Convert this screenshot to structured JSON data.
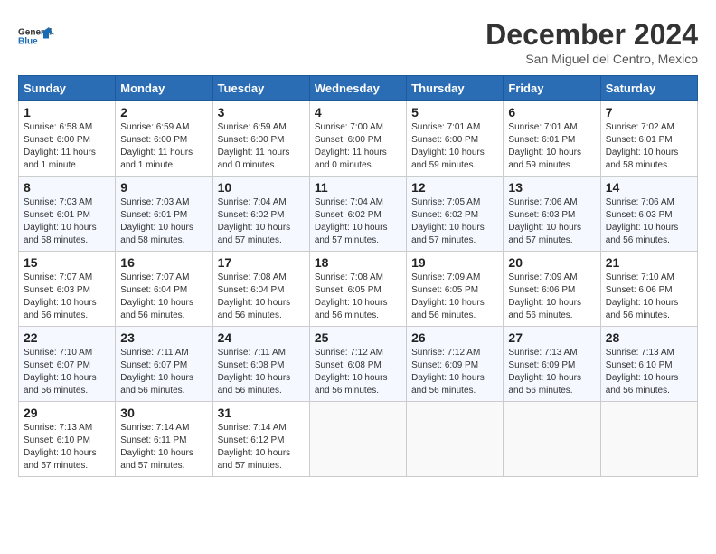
{
  "logo": {
    "line1": "General",
    "line2": "Blue"
  },
  "header": {
    "title": "December 2024",
    "subtitle": "San Miguel del Centro, Mexico"
  },
  "weekdays": [
    "Sunday",
    "Monday",
    "Tuesday",
    "Wednesday",
    "Thursday",
    "Friday",
    "Saturday"
  ],
  "weeks": [
    [
      {
        "day": "1",
        "info": "Sunrise: 6:58 AM\nSunset: 6:00 PM\nDaylight: 11 hours\nand 1 minute."
      },
      {
        "day": "2",
        "info": "Sunrise: 6:59 AM\nSunset: 6:00 PM\nDaylight: 11 hours\nand 1 minute."
      },
      {
        "day": "3",
        "info": "Sunrise: 6:59 AM\nSunset: 6:00 PM\nDaylight: 11 hours\nand 0 minutes."
      },
      {
        "day": "4",
        "info": "Sunrise: 7:00 AM\nSunset: 6:00 PM\nDaylight: 11 hours\nand 0 minutes."
      },
      {
        "day": "5",
        "info": "Sunrise: 7:01 AM\nSunset: 6:00 PM\nDaylight: 10 hours\nand 59 minutes."
      },
      {
        "day": "6",
        "info": "Sunrise: 7:01 AM\nSunset: 6:01 PM\nDaylight: 10 hours\nand 59 minutes."
      },
      {
        "day": "7",
        "info": "Sunrise: 7:02 AM\nSunset: 6:01 PM\nDaylight: 10 hours\nand 58 minutes."
      }
    ],
    [
      {
        "day": "8",
        "info": "Sunrise: 7:03 AM\nSunset: 6:01 PM\nDaylight: 10 hours\nand 58 minutes."
      },
      {
        "day": "9",
        "info": "Sunrise: 7:03 AM\nSunset: 6:01 PM\nDaylight: 10 hours\nand 58 minutes."
      },
      {
        "day": "10",
        "info": "Sunrise: 7:04 AM\nSunset: 6:02 PM\nDaylight: 10 hours\nand 57 minutes."
      },
      {
        "day": "11",
        "info": "Sunrise: 7:04 AM\nSunset: 6:02 PM\nDaylight: 10 hours\nand 57 minutes."
      },
      {
        "day": "12",
        "info": "Sunrise: 7:05 AM\nSunset: 6:02 PM\nDaylight: 10 hours\nand 57 minutes."
      },
      {
        "day": "13",
        "info": "Sunrise: 7:06 AM\nSunset: 6:03 PM\nDaylight: 10 hours\nand 57 minutes."
      },
      {
        "day": "14",
        "info": "Sunrise: 7:06 AM\nSunset: 6:03 PM\nDaylight: 10 hours\nand 56 minutes."
      }
    ],
    [
      {
        "day": "15",
        "info": "Sunrise: 7:07 AM\nSunset: 6:03 PM\nDaylight: 10 hours\nand 56 minutes."
      },
      {
        "day": "16",
        "info": "Sunrise: 7:07 AM\nSunset: 6:04 PM\nDaylight: 10 hours\nand 56 minutes."
      },
      {
        "day": "17",
        "info": "Sunrise: 7:08 AM\nSunset: 6:04 PM\nDaylight: 10 hours\nand 56 minutes."
      },
      {
        "day": "18",
        "info": "Sunrise: 7:08 AM\nSunset: 6:05 PM\nDaylight: 10 hours\nand 56 minutes."
      },
      {
        "day": "19",
        "info": "Sunrise: 7:09 AM\nSunset: 6:05 PM\nDaylight: 10 hours\nand 56 minutes."
      },
      {
        "day": "20",
        "info": "Sunrise: 7:09 AM\nSunset: 6:06 PM\nDaylight: 10 hours\nand 56 minutes."
      },
      {
        "day": "21",
        "info": "Sunrise: 7:10 AM\nSunset: 6:06 PM\nDaylight: 10 hours\nand 56 minutes."
      }
    ],
    [
      {
        "day": "22",
        "info": "Sunrise: 7:10 AM\nSunset: 6:07 PM\nDaylight: 10 hours\nand 56 minutes."
      },
      {
        "day": "23",
        "info": "Sunrise: 7:11 AM\nSunset: 6:07 PM\nDaylight: 10 hours\nand 56 minutes."
      },
      {
        "day": "24",
        "info": "Sunrise: 7:11 AM\nSunset: 6:08 PM\nDaylight: 10 hours\nand 56 minutes."
      },
      {
        "day": "25",
        "info": "Sunrise: 7:12 AM\nSunset: 6:08 PM\nDaylight: 10 hours\nand 56 minutes."
      },
      {
        "day": "26",
        "info": "Sunrise: 7:12 AM\nSunset: 6:09 PM\nDaylight: 10 hours\nand 56 minutes."
      },
      {
        "day": "27",
        "info": "Sunrise: 7:13 AM\nSunset: 6:09 PM\nDaylight: 10 hours\nand 56 minutes."
      },
      {
        "day": "28",
        "info": "Sunrise: 7:13 AM\nSunset: 6:10 PM\nDaylight: 10 hours\nand 56 minutes."
      }
    ],
    [
      {
        "day": "29",
        "info": "Sunrise: 7:13 AM\nSunset: 6:10 PM\nDaylight: 10 hours\nand 57 minutes."
      },
      {
        "day": "30",
        "info": "Sunrise: 7:14 AM\nSunset: 6:11 PM\nDaylight: 10 hours\nand 57 minutes."
      },
      {
        "day": "31",
        "info": "Sunrise: 7:14 AM\nSunset: 6:12 PM\nDaylight: 10 hours\nand 57 minutes."
      },
      null,
      null,
      null,
      null
    ]
  ]
}
